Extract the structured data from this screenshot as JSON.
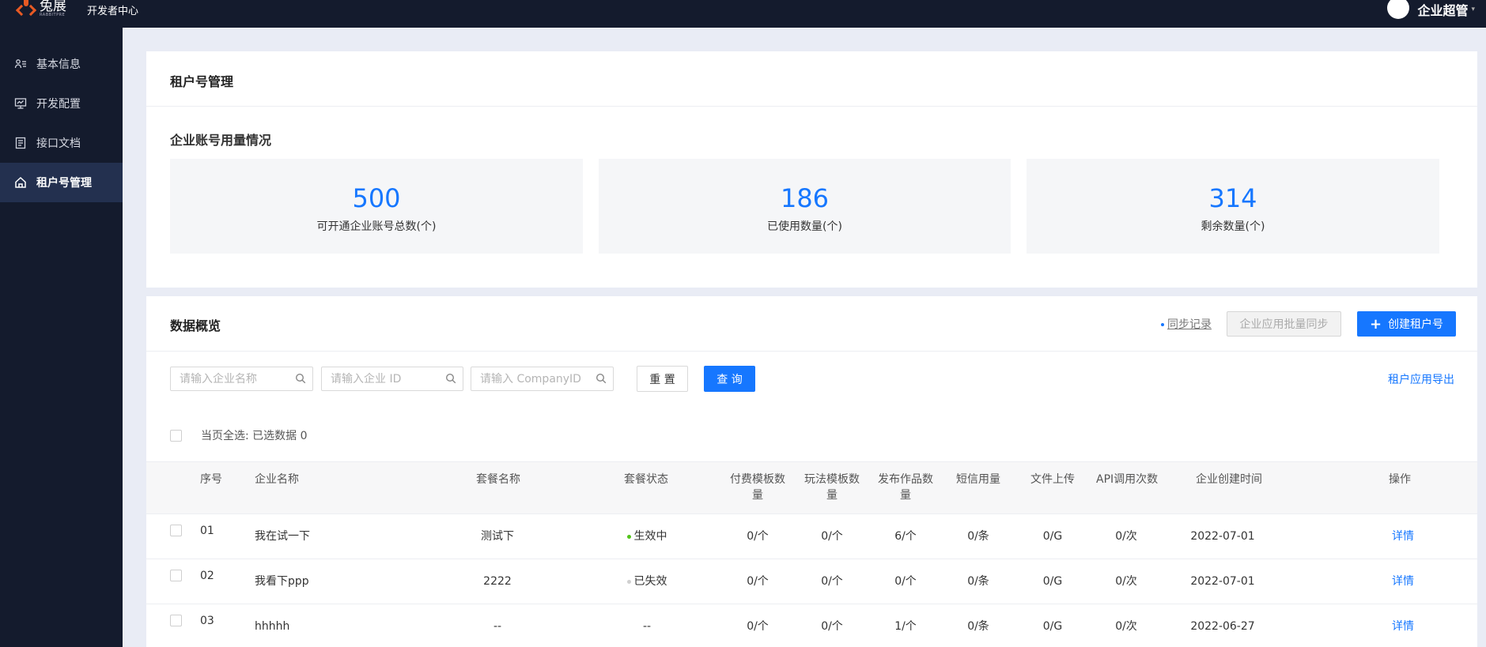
{
  "topbar": {
    "brand_name": "兔展",
    "brand_sub": "RABBITPRE",
    "section": "开发者中心",
    "user_name": "企业超管"
  },
  "sidebar": {
    "items": [
      {
        "label": "基本信息",
        "icon": "user-card-icon"
      },
      {
        "label": "开发配置",
        "icon": "monitor-icon"
      },
      {
        "label": "接口文档",
        "icon": "document-icon"
      },
      {
        "label": "租户号管理",
        "icon": "home-icon",
        "active": true
      }
    ]
  },
  "page": {
    "title": "租户号管理",
    "usage_title": "企业账号用量情况",
    "stats": [
      {
        "value": "500",
        "label": "可开通企业账号总数(个)"
      },
      {
        "value": "186",
        "label": "已使用数量(个)"
      },
      {
        "value": "314",
        "label": "剩余数量(个)"
      }
    ]
  },
  "overview": {
    "title": "数据概览",
    "sync_record": "同步记录",
    "batch_sync": "企业应用批量同步",
    "create_button": "创建租户号",
    "filters": {
      "company_name_placeholder": "请输入企业名称",
      "company_id_placeholder": "请输入企业 ID",
      "companyid_placeholder": "请输入 CompanyID"
    },
    "reset": "重 置",
    "query": "查 询",
    "export": "租户应用导出",
    "select_all": "当页全选:",
    "selected": "已选数据 0"
  },
  "table": {
    "columns": {
      "index": "序号",
      "company": "企业名称",
      "package": "套餐名称",
      "status": "套餐状态",
      "paid_tpl_1": "付费模板数",
      "paid_tpl_2": "量",
      "play_tpl_1": "玩法模板数",
      "play_tpl_2": "量",
      "works_1": "发布作品数",
      "works_2": "量",
      "sms": "短信用量",
      "upload": "文件上传",
      "api": "API调用次数",
      "created": "企业创建时间",
      "action": "操作"
    },
    "rows": [
      {
        "index": "01",
        "company": "我在试一下",
        "package": "测试下",
        "status": "生效中",
        "status_color": "#52c41a",
        "paid": "0/个",
        "play": "0/个",
        "works": "6/个",
        "sms": "0/条",
        "upload": "0/G",
        "api": "0/次",
        "created": "2022-07-01",
        "action": "详情"
      },
      {
        "index": "02",
        "company": "我看下ppp",
        "package": "2222",
        "status": "已失效",
        "status_color": "#d0d0d0",
        "paid": "0/个",
        "play": "0/个",
        "works": "0/个",
        "sms": "0/条",
        "upload": "0/G",
        "api": "0/次",
        "created": "2022-07-01",
        "action": "详情"
      },
      {
        "index": "03",
        "company": "hhhhh",
        "package": "--",
        "status": "--",
        "status_color": "",
        "paid": "0/个",
        "play": "0/个",
        "works": "1/个",
        "sms": "0/条",
        "upload": "0/G",
        "api": "0/次",
        "created": "2022-06-27",
        "action": "详情"
      }
    ]
  },
  "colors": {
    "primary": "#1677ff",
    "nav_bg": "#141b2d",
    "nav_active": "#23304f"
  }
}
